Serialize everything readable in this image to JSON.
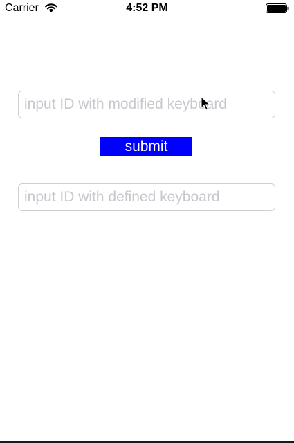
{
  "status_bar": {
    "carrier": "Carrier",
    "time": "4:52 PM",
    "wifi_icon": "wifi-icon",
    "battery_icon": "battery-icon"
  },
  "form": {
    "field1_placeholder": "input ID with modified keyboard",
    "field1_value": "",
    "submit_label": "submit",
    "field2_placeholder": "input ID with defined keyboard",
    "field2_value": ""
  },
  "colors": {
    "submit_background": "#0000ff",
    "submit_text": "#ffffff",
    "placeholder": "#c7c7cd",
    "field_border": "#cfcfcf"
  },
  "cursor_icon": "arrow-cursor-icon"
}
